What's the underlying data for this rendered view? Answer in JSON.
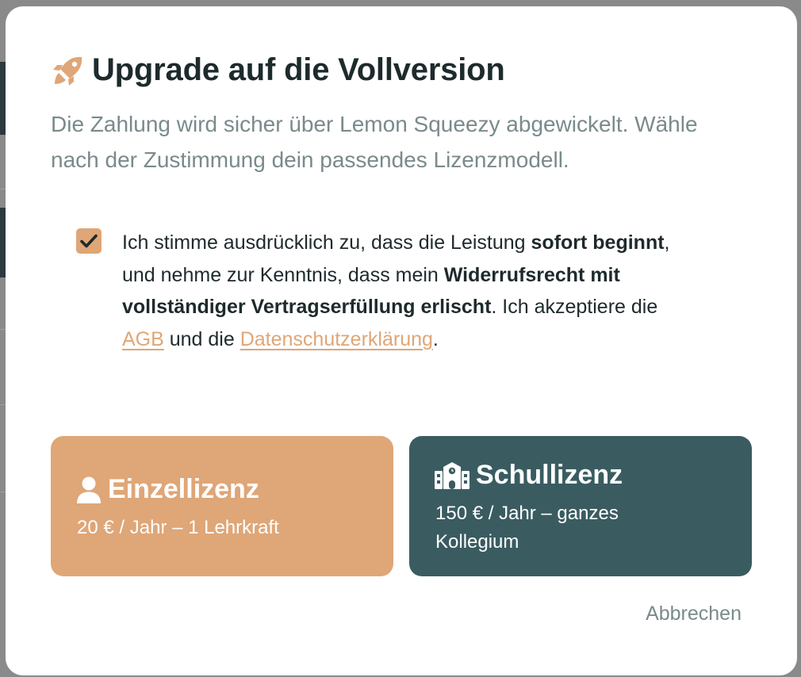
{
  "modal": {
    "title": "Upgrade auf die Vollversion",
    "subtitle": "Die Zahlung wird sicher über Lemon Squeezy abgewickelt. Wähle nach der Zustimmung dein passendes Lizenzmodell.",
    "title_icon": "rocket-icon",
    "accent_color": "#dfa677",
    "dark_color": "#3a5c61"
  },
  "consent": {
    "checked": true,
    "text_part1": "Ich stimme ausdrücklich zu, dass die Leistung ",
    "bold1": "sofort beginnt",
    "text_part2": ", und nehme zur Kenntnis, dass mein ",
    "bold2": "Widerrufsrecht mit vollständiger Vertragserfüllung erlischt",
    "text_part3": ". Ich akzeptiere die ",
    "agb_link": "AGB",
    "text_part4": " und die ",
    "privacy_link": "Datenschutzerklärung",
    "text_part5": "."
  },
  "licenses": [
    {
      "icon": "person-icon",
      "title": "Einzellizenz",
      "description": "20 € / Jahr – 1 Lehrkraft"
    },
    {
      "icon": "school-icon",
      "title": "Schullizenz",
      "description": "150 € / Jahr – ganzes Kollegium"
    }
  ],
  "cancel_label": "Abbrechen"
}
